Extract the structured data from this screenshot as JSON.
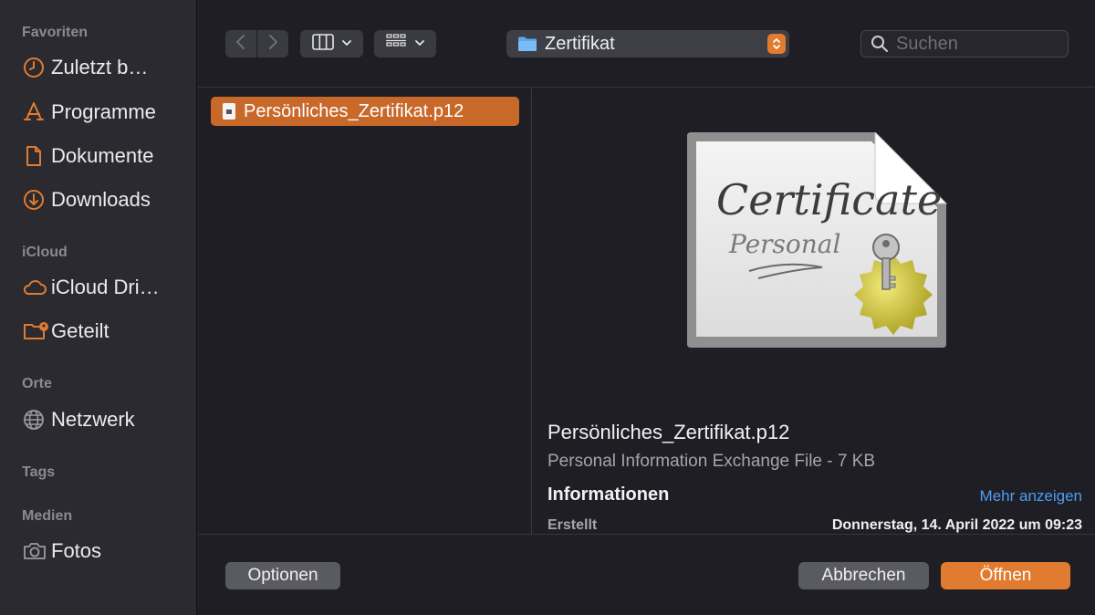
{
  "sidebar": {
    "favorites_label": "Favoriten",
    "favorites": [
      {
        "label": "Zuletzt b…",
        "icon": "clock-icon"
      },
      {
        "label": "Programme",
        "icon": "apps-icon"
      },
      {
        "label": "Dokumente",
        "icon": "document-icon"
      },
      {
        "label": "Downloads",
        "icon": "download-icon"
      }
    ],
    "icloud_label": "iCloud",
    "icloud": [
      {
        "label": "iCloud Dri…",
        "icon": "cloud-icon"
      },
      {
        "label": "Geteilt",
        "icon": "shared-folder-icon"
      }
    ],
    "places_label": "Orte",
    "places": [
      {
        "label": "Netzwerk",
        "icon": "globe-icon"
      }
    ],
    "tags_label": "Tags",
    "media_label": "Medien",
    "media": [
      {
        "label": "Fotos",
        "icon": "camera-icon"
      }
    ]
  },
  "toolbar": {
    "path": "Zertifikat",
    "search_placeholder": "Suchen"
  },
  "files": [
    {
      "name": "Persönliches_Zertifikat.p12",
      "selected": true
    }
  ],
  "preview": {
    "name": "Persönliches_Zertifikat.p12",
    "kind": "Personal Information Exchange File - 7 KB",
    "info_heading": "Informationen",
    "more_link": "Mehr anzeigen",
    "created_label": "Erstellt",
    "created_value": "Donnerstag, 14. April 2022 um 09:23",
    "icon_text_1": "Certificate",
    "icon_text_2": "Personal"
  },
  "buttons": {
    "options": "Optionen",
    "cancel": "Abbrechen",
    "open": "Öffnen"
  },
  "colors": {
    "accent": "#e07b2f",
    "link": "#4e9df5",
    "selection": "#c8692a"
  }
}
